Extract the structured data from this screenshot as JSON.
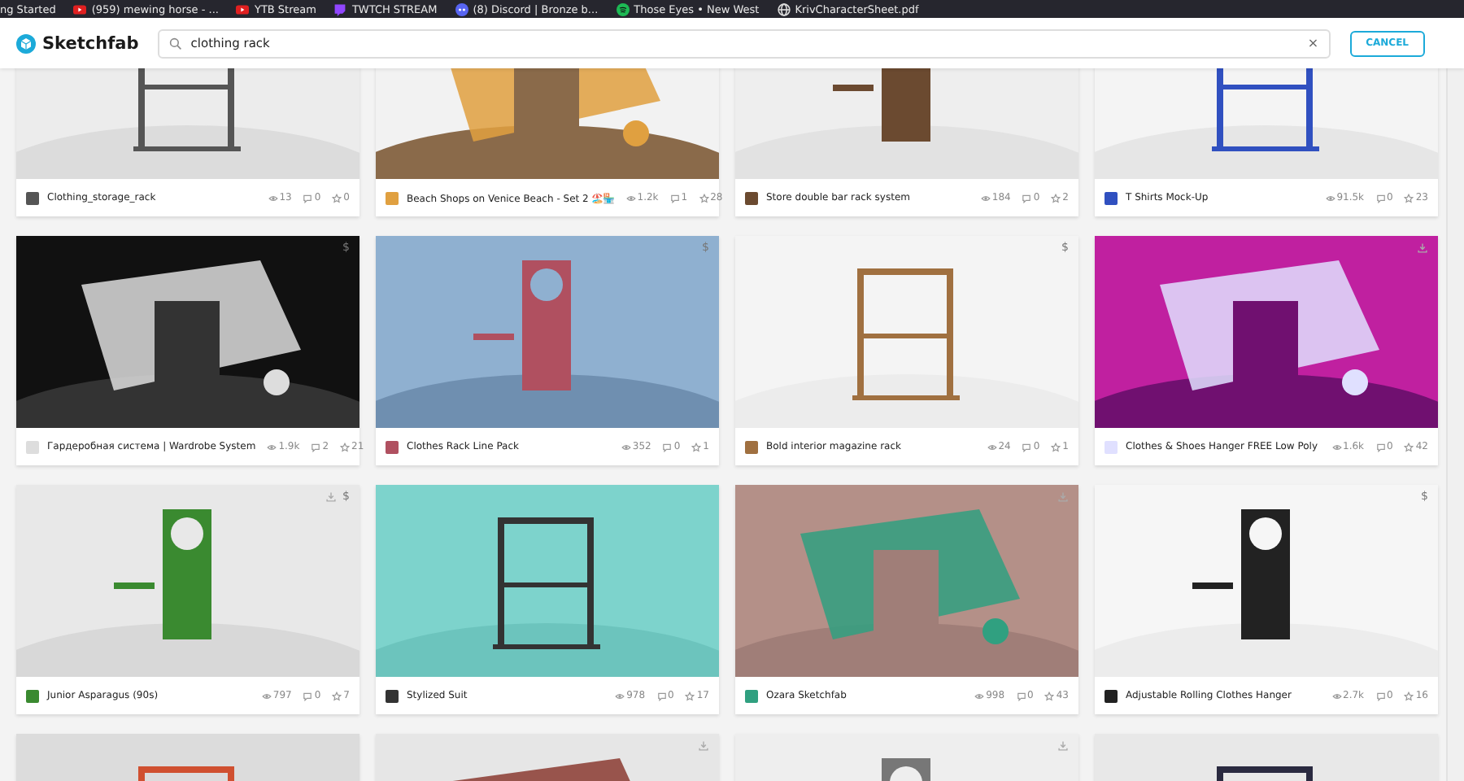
{
  "bookmarks": [
    {
      "label": "ng Started",
      "kind": "none"
    },
    {
      "label": "(959) mewing horse - ...",
      "kind": "video"
    },
    {
      "label": "YTB Stream",
      "kind": "video"
    },
    {
      "label": "TWTCH STREAM",
      "kind": "stream"
    },
    {
      "label": "(8) Discord | Bronze b...",
      "kind": "chat"
    },
    {
      "label": "Those Eyes • New West",
      "kind": "music"
    },
    {
      "label": "KrivCharacterSheet.pdf",
      "kind": "web"
    }
  ],
  "header": {
    "logo": "Sketchfab",
    "search": {
      "value": "clothing rack",
      "clear": "×"
    },
    "cancel": "CANCEL"
  },
  "models": [
    {
      "title": "Clothing_storage_rack",
      "views": "13",
      "comments": "0",
      "likes": "0"
    },
    {
      "title": "Beach Shops on Venice Beach - Set 2 🏖️🏪",
      "views": "1.2k",
      "comments": "1",
      "likes": "28"
    },
    {
      "title": "Store double bar rack system",
      "views": "184",
      "comments": "0",
      "likes": "2"
    },
    {
      "title": "T Shirts Mock-Up",
      "views": "91.5k",
      "comments": "0",
      "likes": "23"
    },
    {
      "title": "Гардеробная система | Wardrobe System",
      "views": "1.9k",
      "comments": "2",
      "likes": "21",
      "price": "$"
    },
    {
      "title": "Clothes Rack Line Pack",
      "views": "352",
      "comments": "0",
      "likes": "1",
      "price": "$"
    },
    {
      "title": "Bold interior magazine rack",
      "views": "24",
      "comments": "0",
      "likes": "1",
      "price": "$"
    },
    {
      "title": "Clothes & Shoes Hanger FREE Low Poly",
      "views": "1.6k",
      "comments": "0",
      "likes": "42",
      "downloadable": true
    },
    {
      "title": "Junior Asparagus (90s)",
      "views": "797",
      "comments": "0",
      "likes": "7",
      "price": "$",
      "downloadable": true
    },
    {
      "title": "Stylized Suit",
      "views": "978",
      "comments": "0",
      "likes": "17"
    },
    {
      "title": "Ozara Sketchfab",
      "views": "998",
      "comments": "0",
      "likes": "43",
      "downloadable": true
    },
    {
      "title": "Adjustable Rolling Clothes Hanger",
      "views": "2.7k",
      "comments": "0",
      "likes": "16",
      "price": "$"
    },
    {
      "kind": "picture"
    },
    {
      "kind": "picture",
      "downloadable": true
    },
    {
      "kind": "picture",
      "downloadable": true
    },
    {
      "kind": "picture"
    }
  ]
}
